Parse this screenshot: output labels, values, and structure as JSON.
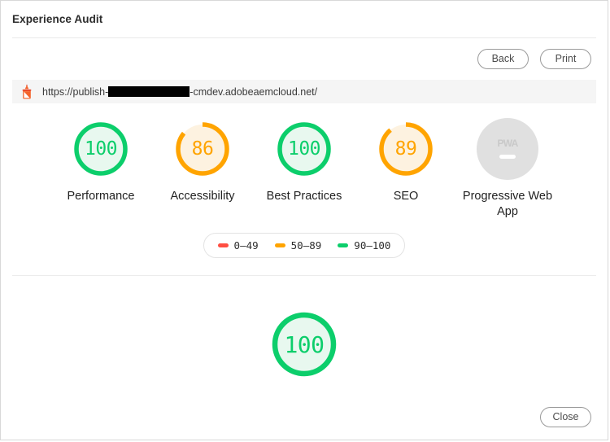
{
  "window": {
    "title": "Experience Audit"
  },
  "toolbar": {
    "back_label": "Back",
    "print_label": "Print"
  },
  "url_bar": {
    "icon": "lighthouse-icon",
    "prefix": "https://publish-",
    "redacted": "",
    "suffix": "-cmdev.adobeaemcloud.net/"
  },
  "colors": {
    "green": "#0CCE6B",
    "green_fill": "#E8F8EF",
    "orange": "#FFA400",
    "orange_fill": "#FEF5E6",
    "red": "#FF4E42",
    "gray": "#E0E0E0",
    "track_green": "#E8F8EF",
    "track_orange": "#FDF2E0"
  },
  "scores": [
    {
      "name": "performance",
      "label": "Performance",
      "value": "100",
      "percent": 100,
      "color": "#0CCE6B",
      "track": "#E8F8EF",
      "type": "gauge"
    },
    {
      "name": "accessibility",
      "label": "Accessibility",
      "value": "86",
      "percent": 86,
      "color": "#FFA400",
      "track": "#FDF2E0",
      "type": "gauge"
    },
    {
      "name": "best-practices",
      "label": "Best Practices",
      "value": "100",
      "percent": 100,
      "color": "#0CCE6B",
      "track": "#E8F8EF",
      "type": "gauge"
    },
    {
      "name": "seo",
      "label": "SEO",
      "value": "89",
      "percent": 89,
      "color": "#FFA400",
      "track": "#FDF2E0",
      "type": "gauge"
    },
    {
      "name": "pwa",
      "label": "Progressive Web App",
      "value": "PWA",
      "percent": 0,
      "color": "#C9C9C9",
      "track": "#E0E0E0",
      "type": "badge"
    }
  ],
  "legend": {
    "items": [
      {
        "range": "0–49",
        "color": "#FF4E42"
      },
      {
        "range": "50–89",
        "color": "#FFA400"
      },
      {
        "range": "90–100",
        "color": "#0CCE6B"
      }
    ]
  },
  "summary_gauge": {
    "label": "overall-score",
    "value": "100",
    "percent": 100,
    "color": "#0CCE6B",
    "track": "#E8F8EF"
  },
  "footer": {
    "close_label": "Close"
  }
}
